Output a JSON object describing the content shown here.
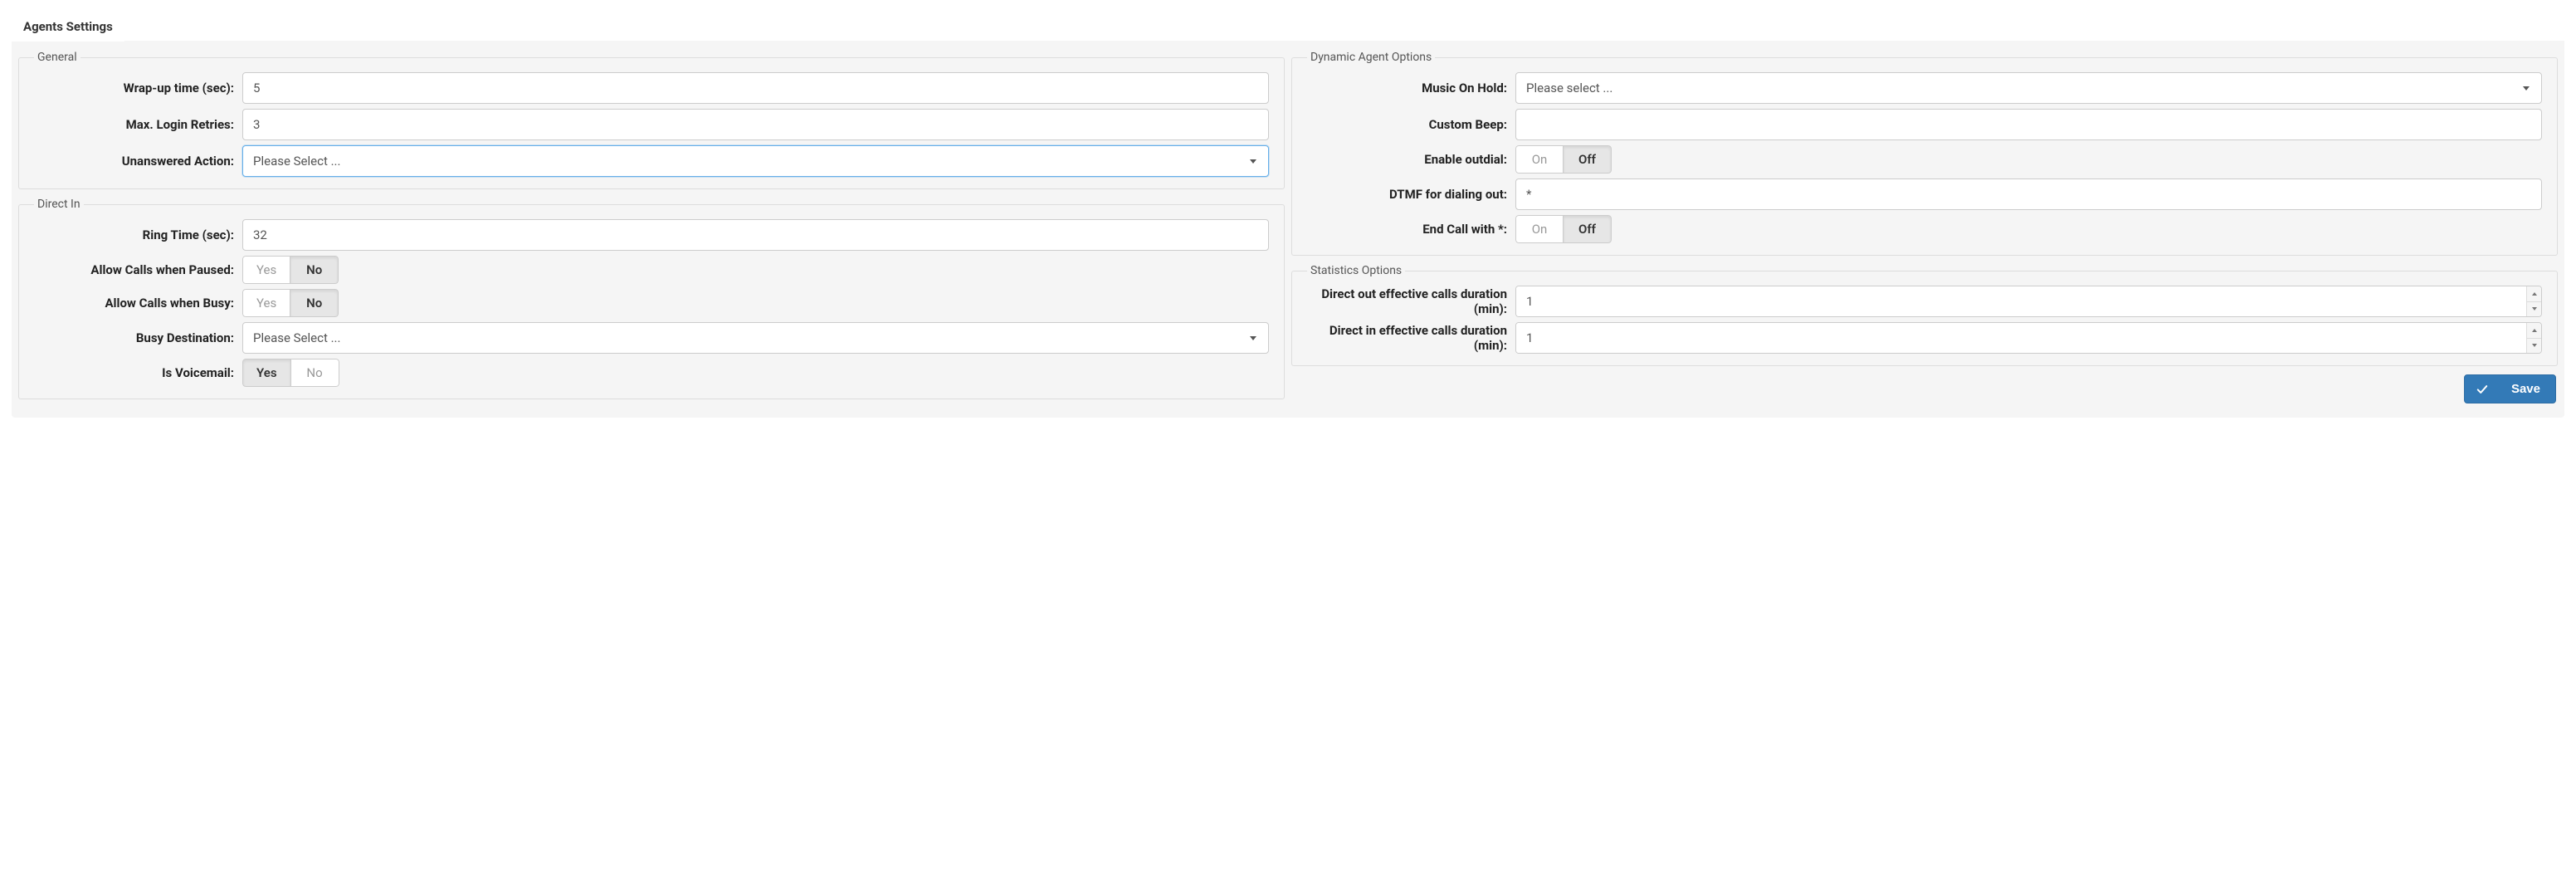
{
  "tabs": {
    "agents_settings": "Agents Settings"
  },
  "toggle": {
    "yes": "Yes",
    "no": "No",
    "on": "On",
    "off": "Off"
  },
  "general": {
    "legend": "General",
    "wrapup_label": "Wrap-up time (sec):",
    "wrapup_value": "5",
    "max_login_retries_label": "Max. Login Retries:",
    "max_login_retries_value": "3",
    "unanswered_action_label": "Unanswered Action:",
    "unanswered_action_value": "Please Select ..."
  },
  "direct_in": {
    "legend": "Direct In",
    "ring_time_label": "Ring Time (sec):",
    "ring_time_value": "32",
    "allow_paused_label": "Allow Calls when Paused:",
    "allow_paused_value": "No",
    "allow_busy_label": "Allow Calls when Busy:",
    "allow_busy_value": "No",
    "busy_dest_label": "Busy Destination:",
    "busy_dest_value": "Please Select ...",
    "is_voicemail_label": "Is Voicemail:",
    "is_voicemail_value": "Yes"
  },
  "dynamic": {
    "legend": "Dynamic Agent Options",
    "moh_label": "Music On Hold:",
    "moh_value": "Please select ...",
    "custom_beep_label": "Custom Beep:",
    "custom_beep_value": "",
    "enable_outdial_label": "Enable outdial:",
    "enable_outdial_value": "Off",
    "dtmf_label": "DTMF for dialing out:",
    "dtmf_value": "*",
    "end_call_label": "End Call with *:",
    "end_call_value": "Off"
  },
  "stats": {
    "legend": "Statistics Options",
    "direct_out_label": "Direct out effective calls duration (min):",
    "direct_out_value": "1",
    "direct_in_label": "Direct in effective calls duration (min):",
    "direct_in_value": "1"
  },
  "save_label": "Save"
}
